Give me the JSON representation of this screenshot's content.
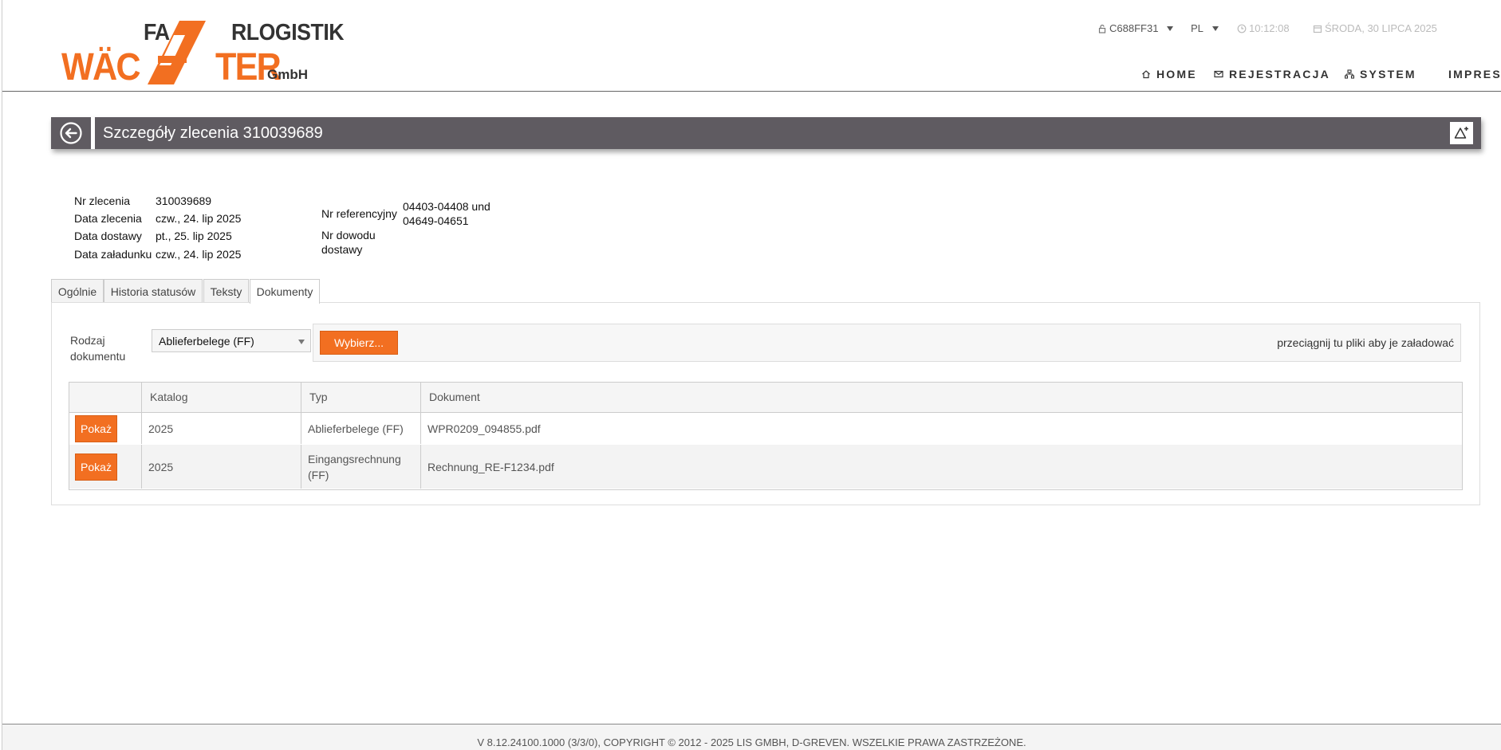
{
  "header": {
    "logo": {
      "line1_left": "FA",
      "line1_right": "RLOGISTIK",
      "line2_left": "WÄC",
      "line2_right": "TER",
      "suffix": "GmbH"
    },
    "user_code": "C688FF31",
    "language": "PL",
    "time": "10:12:08",
    "date": "ŚRODA, 30 LIPCA 2025",
    "nav": [
      "HOME",
      "REJESTRACJA",
      "SYSTEM",
      "IMPRESUM"
    ]
  },
  "titlebar": {
    "title": "Szczegóły zlecenia 310039689"
  },
  "details": {
    "order_no_label": "Nr zlecenia",
    "order_no": "310039689",
    "order_date_label": "Data zlecenia",
    "order_date": "czw., 24. lip 2025",
    "delivery_date_label": "Data dostawy",
    "delivery_date": "pt., 25. lip 2025",
    "loading_date_label": "Data załadunku",
    "loading_date": "czw., 24. lip 2025",
    "reference_label": "Nr referencyjny",
    "reference_value": "04403-04408 und 04649-04651",
    "delivery_note_label": "Nr dowodu dostawy"
  },
  "tabs": [
    "Ogólnie",
    "Historia statusów",
    "Teksty",
    "Dokumenty"
  ],
  "active_tab": "Dokumenty",
  "documents": {
    "doc_type_label": "Rodzaj dokumentu",
    "doc_type_value": "Ablieferbelege (FF)",
    "choose_label": "Wybierz...",
    "drop_hint": "przeciągnij tu pliki aby je załadować",
    "columns": [
      "",
      "Katalog",
      "Typ",
      "Dokument"
    ],
    "rows": [
      {
        "action": "Pokaż",
        "catalog": "2025",
        "type": "Ablieferbelege (FF)",
        "document": "WPR0209_094855.pdf"
      },
      {
        "action": "Pokaż",
        "catalog": "2025",
        "type": "Eingangsrechnung (FF)",
        "document": "Rechnung_RE-F1234.pdf"
      }
    ]
  },
  "footer": {
    "text": "V 8.12.24100.1000 (3/3/0), COPYRIGHT © 2012 - 2025 LIS GMBH, D-GREVEN. WSZELKIE PRAWA ZASTRZEŻONE."
  },
  "colors": {
    "accent": "#f26f21",
    "titlebar": "#5f5b61"
  }
}
